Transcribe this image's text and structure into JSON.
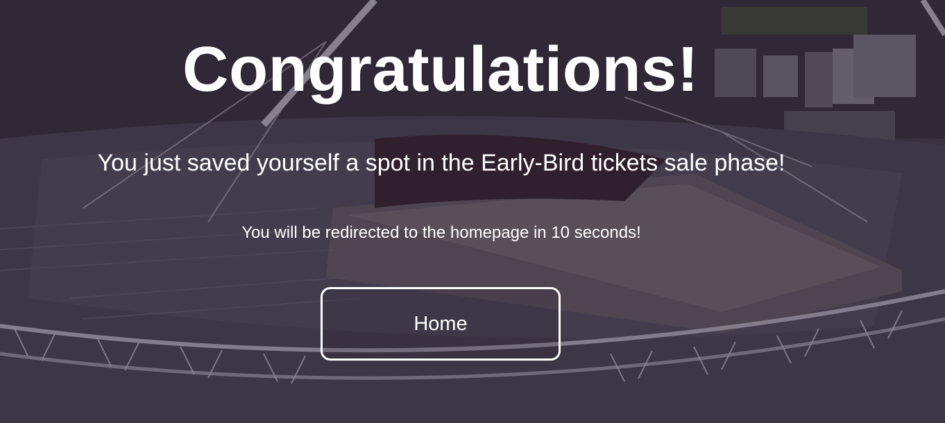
{
  "page": {
    "title": "Congratulations!",
    "subtitle": "You just saved yourself a spot in the Early-Bird tickets sale phase!",
    "redirect_notice": "You will be redirected to the homepage in 10 seconds!"
  },
  "actions": {
    "home_label": "Home"
  },
  "background": {
    "description_icon": "stadium-photo",
    "overlay_color": "#1e1428"
  }
}
